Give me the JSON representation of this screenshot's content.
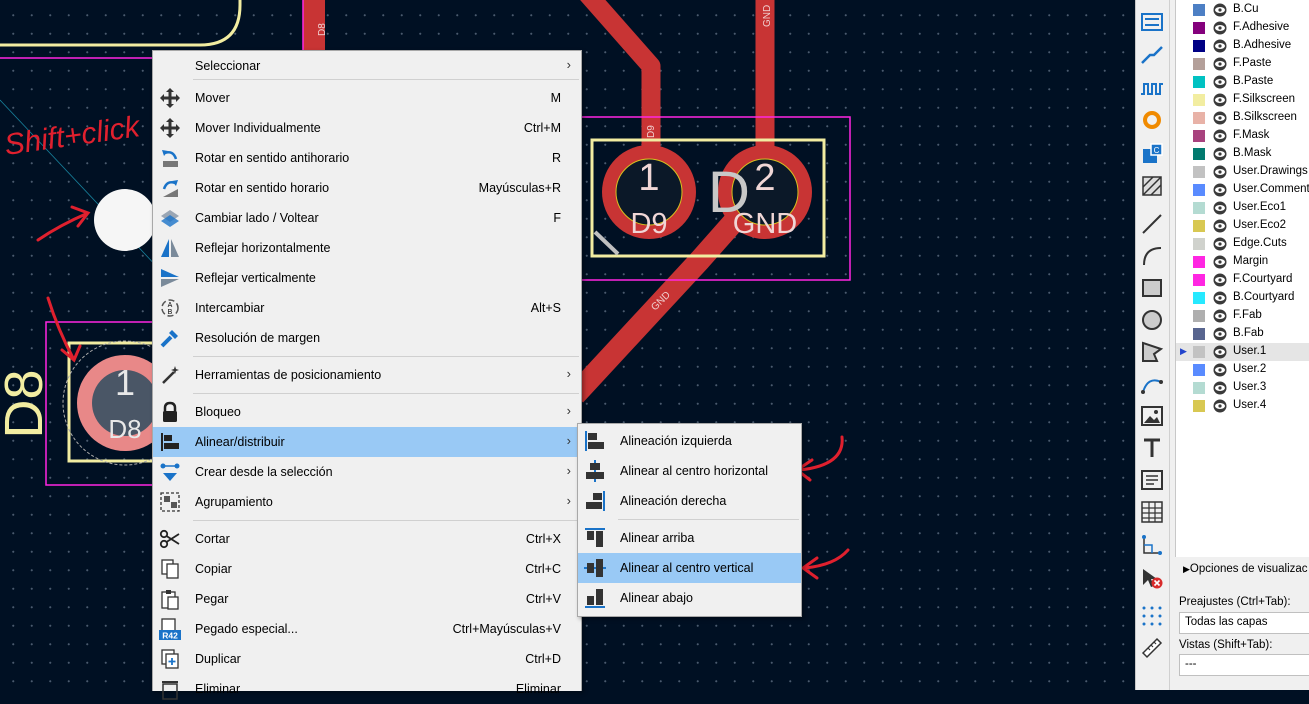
{
  "colors": {
    "pcb_background": "#001023",
    "copper": "#c83434",
    "silkscreen": "#f2eda1",
    "courtyard": "#ff26e2",
    "menu_bg": "#f0f0f0",
    "highlight": "#99c9f5",
    "annotation": "#e0202e"
  },
  "board": {
    "pads": [
      {
        "number": "1",
        "net": "D9"
      },
      {
        "number": "2",
        "net": "GND"
      },
      {
        "number": "1",
        "net": "D8"
      }
    ],
    "track_labels": [
      "D8",
      "GND",
      "D9",
      "GND"
    ],
    "footprint_refs": [
      "D8",
      "D"
    ],
    "annotation_text": "Shift+click"
  },
  "context_menu": {
    "items": [
      {
        "label": "Seleccionar",
        "shortcut": "",
        "submenu": true,
        "icon": "none"
      },
      {
        "label": "Mover",
        "shortcut": "M",
        "submenu": false,
        "icon": "move-icon"
      },
      {
        "label": "Mover Individualmente",
        "shortcut": "Ctrl+M",
        "submenu": false,
        "icon": "move-individually-icon"
      },
      {
        "label": "Rotar en sentido antihorario",
        "shortcut": "R",
        "submenu": false,
        "icon": "rotate-ccw-icon"
      },
      {
        "label": "Rotar en sentido horario",
        "shortcut": "Mayúsculas+R",
        "submenu": false,
        "icon": "rotate-cw-icon"
      },
      {
        "label": "Cambiar lado / Voltear",
        "shortcut": "F",
        "submenu": false,
        "icon": "flip-icon"
      },
      {
        "label": "Reflejar horizontalmente",
        "shortcut": "",
        "submenu": false,
        "icon": "mirror-h-icon"
      },
      {
        "label": "Reflejar verticalmente",
        "shortcut": "",
        "submenu": false,
        "icon": "mirror-v-icon"
      },
      {
        "label": "Intercambiar",
        "shortcut": "Alt+S",
        "submenu": false,
        "icon": "swap-icon"
      },
      {
        "label": "Resolución de margen",
        "shortcut": "",
        "submenu": false,
        "icon": "clearance-icon"
      },
      {
        "label": "Herramientas de posicionamiento",
        "shortcut": "",
        "submenu": true,
        "icon": "position-tools-icon"
      },
      {
        "label": "Bloqueo",
        "shortcut": "",
        "submenu": true,
        "icon": "lock-icon"
      },
      {
        "label": "Alinear/distribuir",
        "shortcut": "",
        "submenu": true,
        "icon": "align-icon"
      },
      {
        "label": "Crear desde la selección",
        "shortcut": "",
        "submenu": true,
        "icon": "create-from-selection-icon"
      },
      {
        "label": "Agrupamiento",
        "shortcut": "",
        "submenu": true,
        "icon": "group-icon"
      },
      {
        "label": "Cortar",
        "shortcut": "Ctrl+X",
        "submenu": false,
        "icon": "scissors-icon"
      },
      {
        "label": "Copiar",
        "shortcut": "Ctrl+C",
        "submenu": false,
        "icon": "copy-icon"
      },
      {
        "label": "Pegar",
        "shortcut": "Ctrl+V",
        "submenu": false,
        "icon": "paste-icon"
      },
      {
        "label": "Pegado especial...",
        "shortcut": "Ctrl+Mayúsculas+V",
        "submenu": false,
        "icon": "paste-special-icon"
      },
      {
        "label": "Duplicar",
        "shortcut": "Ctrl+D",
        "submenu": false,
        "icon": "duplicate-icon"
      },
      {
        "label": "Eliminar",
        "shortcut": "Eliminar",
        "submenu": false,
        "icon": "trash-icon"
      }
    ],
    "paste_special_badge": "R42",
    "highlighted": "Alinear/distribuir"
  },
  "align_submenu": {
    "items": [
      {
        "label": "Alineación izquierda"
      },
      {
        "label": "Alinear al centro horizontal"
      },
      {
        "label": "Alineación derecha"
      },
      {
        "label": "Alinear arriba"
      },
      {
        "label": "Alinear al centro vertical"
      },
      {
        "label": "Alinear abajo"
      }
    ],
    "highlighted": "Alinear al centro vertical"
  },
  "toolbar_icons": [
    "route-diff-pair-icon",
    "route-track-icon",
    "tune-length-icon",
    "via-icon",
    "add-zone-icon",
    "add-rule-area-icon",
    "line-icon",
    "arc-icon",
    "rectangle-icon",
    "circle-icon",
    "polygon-icon",
    "bezier-icon",
    "image-icon",
    "text-icon",
    "textbox-icon",
    "table-icon",
    "dimension-icon",
    "delete-icon",
    "grid-origin-icon",
    "measure-icon"
  ],
  "layers": [
    {
      "name": "B.Cu",
      "color": "#4d7fc4"
    },
    {
      "name": "F.Adhesive",
      "color": "#84007c"
    },
    {
      "name": "B.Adhesive",
      "color": "#000084"
    },
    {
      "name": "F.Paste",
      "color": "#b4a09a"
    },
    {
      "name": "B.Paste",
      "color": "#00c2c2"
    },
    {
      "name": "F.Silkscreen",
      "color": "#f2eda1"
    },
    {
      "name": "B.Silkscreen",
      "color": "#e8b2a7"
    },
    {
      "name": "F.Mask",
      "color": "#a8427e"
    },
    {
      "name": "B.Mask",
      "color": "#027a6f"
    },
    {
      "name": "User.Drawings",
      "color": "#c2c2c2"
    },
    {
      "name": "User.Comments",
      "color": "#598bff"
    },
    {
      "name": "User.Eco1",
      "color": "#b4dbd2"
    },
    {
      "name": "User.Eco2",
      "color": "#d8c852"
    },
    {
      "name": "Edge.Cuts",
      "color": "#d0d2cd"
    },
    {
      "name": "Margin",
      "color": "#ff26e2"
    },
    {
      "name": "F.Courtyard",
      "color": "#ff26e2"
    },
    {
      "name": "B.Courtyard",
      "color": "#26e9ff"
    },
    {
      "name": "F.Fab",
      "color": "#afafaf"
    },
    {
      "name": "B.Fab",
      "color": "#58658f"
    },
    {
      "name": "User.1",
      "color": "#c2c2c2"
    },
    {
      "name": "User.2",
      "color": "#598bff"
    },
    {
      "name": "User.3",
      "color": "#b4dbd2"
    },
    {
      "name": "User.4",
      "color": "#d8c852"
    }
  ],
  "active_layer": "User.1",
  "display_options_label": "Opciones de visualizac",
  "presets": {
    "label": "Preajustes (Ctrl+Tab):",
    "value": "Todas las capas"
  },
  "views": {
    "label": "Vistas (Shift+Tab):",
    "value": "---"
  }
}
